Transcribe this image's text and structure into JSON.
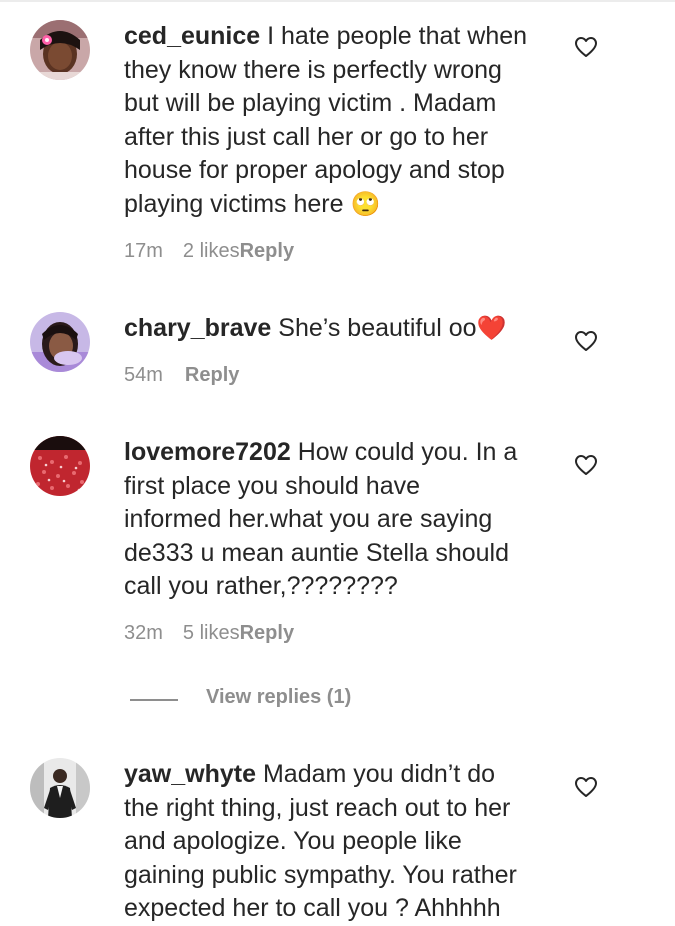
{
  "comments": [
    {
      "username": "ced_eunice",
      "lines": [
        "I hate people that when",
        "they know there is perfectly wrong",
        "but will be playing victim . Madam",
        "after this just call her or go to her",
        "house for proper apology and stop",
        "playing victims here"
      ],
      "emoji": "🙄",
      "time": "17m",
      "likes": "2 likes",
      "reply_label": "Reply",
      "avatar_icon": "avatar-woman-pink-flower"
    },
    {
      "username": "chary_brave",
      "lines": [
        "She’s beautiful oo"
      ],
      "emoji": "❤️",
      "time": "54m",
      "likes": "",
      "reply_label": "Reply",
      "avatar_icon": "avatar-woman-purple"
    },
    {
      "username": "lovemore7202",
      "lines": [
        "How could you. In a",
        "first place you should have",
        "informed her.what you are saying",
        "de333 u mean auntie Stella should",
        "call you rather,????????"
      ],
      "emoji": "",
      "time": "32m",
      "likes": "5 likes",
      "reply_label": "Reply",
      "avatar_icon": "avatar-red-pattern"
    },
    {
      "username": "yaw_whyte",
      "lines": [
        "Madam you didn’t do",
        "the right thing, just reach out to her",
        "and apologize. You people like",
        "gaining public sympathy. You rather",
        "expected her to call you ? Ahhhhh"
      ],
      "emoji": "",
      "time": "",
      "likes": "",
      "reply_label": "",
      "avatar_icon": "avatar-man-suit"
    }
  ],
  "view_replies": {
    "label": "View replies (1)"
  },
  "colors": {
    "text": "#262626",
    "secondary": "#8e8e8e",
    "heart_red": "#e0262b"
  },
  "icons": {
    "like": "heart-outline-icon"
  }
}
